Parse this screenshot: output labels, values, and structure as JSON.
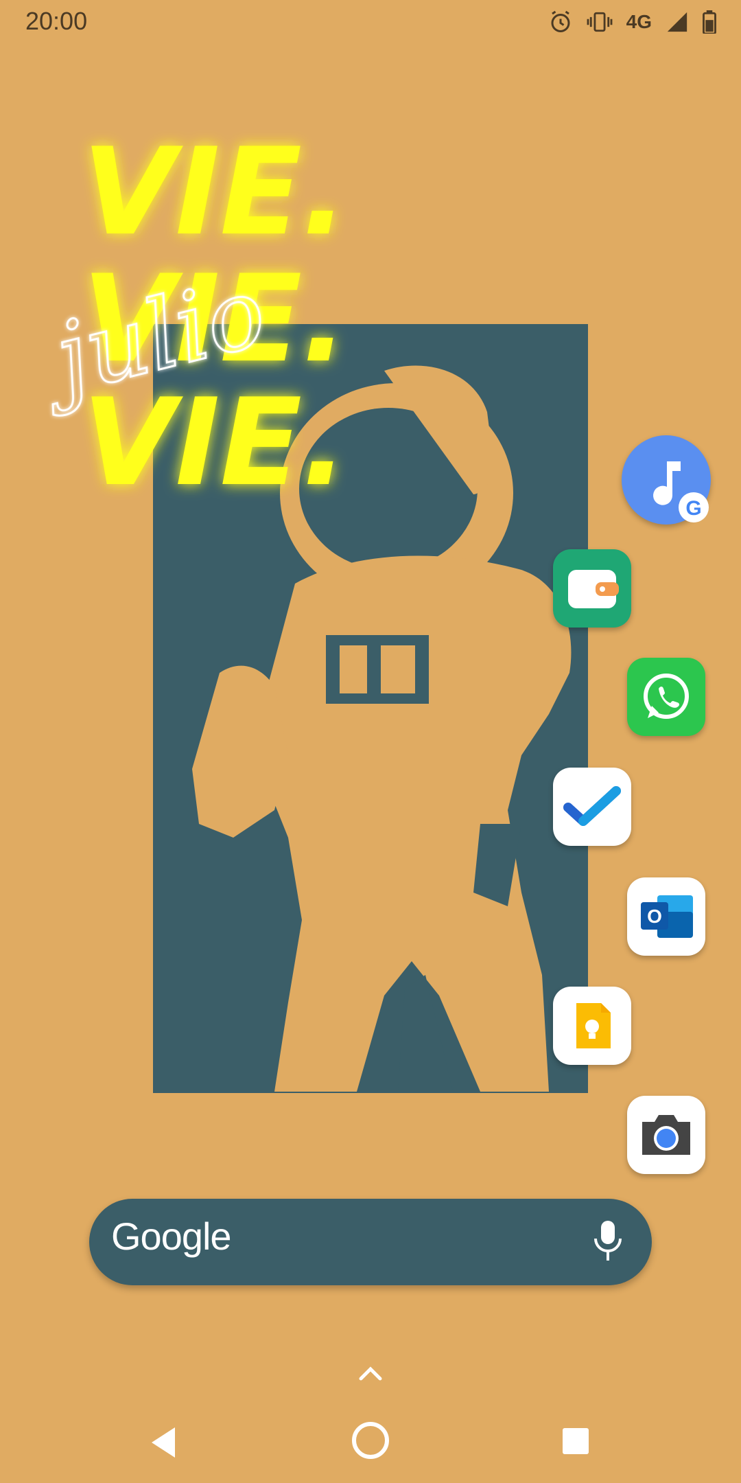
{
  "status_bar": {
    "time": "20:00",
    "network": "4G"
  },
  "wallpaper": {
    "headline_lines": [
      "VIE.",
      "VIE.",
      "VIE."
    ],
    "script_text": "julio"
  },
  "apps": [
    {
      "name": "YouTube Music / Google Play Music",
      "icon": "music-note-icon"
    },
    {
      "name": "Wallet",
      "icon": "wallet-icon"
    },
    {
      "name": "WhatsApp",
      "icon": "whatsapp-icon"
    },
    {
      "name": "Microsoft To Do",
      "icon": "checkmark-icon"
    },
    {
      "name": "Outlook",
      "icon": "outlook-icon"
    },
    {
      "name": "Google Keep",
      "icon": "lightbulb-icon"
    },
    {
      "name": "Camera",
      "icon": "camera-icon"
    }
  ],
  "search": {
    "brand": "Google",
    "voice_icon": "mic-icon"
  },
  "colors": {
    "background": "#e0ab62",
    "panel": "#3b5e68",
    "neon_text": "#ffff1a"
  }
}
